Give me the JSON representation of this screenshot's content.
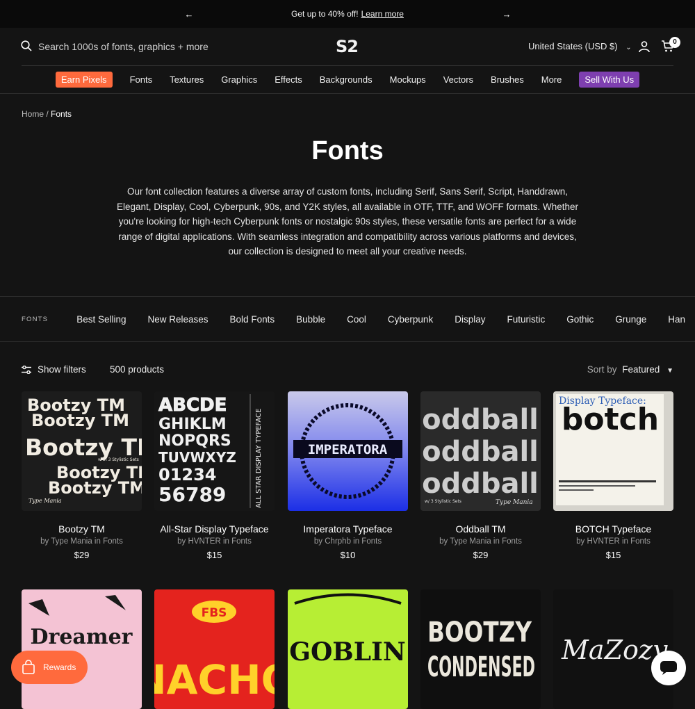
{
  "announcement": {
    "text": "Get up to 40% off!",
    "link": "Learn more"
  },
  "header": {
    "search_placeholder": "Search 1000s of fonts, graphics + more",
    "logo": "S2",
    "country": "United States (USD $)",
    "cart_count": "0"
  },
  "nav": {
    "promo_left": "Earn Pixels",
    "items": [
      "Fonts",
      "Textures",
      "Graphics",
      "Effects",
      "Backgrounds",
      "Mockups",
      "Vectors",
      "Brushes",
      "More"
    ],
    "promo_right": "Sell With Us"
  },
  "breadcrumb": {
    "home": "Home",
    "separator": "/",
    "current": "Fonts"
  },
  "page": {
    "title": "Fonts",
    "description": "Our font collection features a diverse array of custom fonts, including Serif, Sans Serif, Script, Handdrawn, Elegant, Display, Cool, Cyberpunk, 90s, and Y2K styles, all available in OTF, TTF, and WOFF formats. Whether you're looking for high-tech Cyberpunk fonts or nostalgic 90s styles, these versatile fonts are perfect for a wide range of digital applications. With seamless integration and compatibility across various platforms and devices, our collection is designed to meet all your creative needs."
  },
  "categories": {
    "label": "FONTS",
    "items": [
      "Best Selling",
      "New Releases",
      "Bold Fonts",
      "Bubble",
      "Cool",
      "Cyberpunk",
      "Display",
      "Futuristic",
      "Gothic",
      "Grunge",
      "Han"
    ]
  },
  "toolbar": {
    "filters": "Show filters",
    "count": "500 products",
    "sort_label": "Sort by",
    "sort_value": "Featured"
  },
  "products": [
    {
      "name": "Bootzy TM",
      "by": "by Type Mania in Fonts",
      "price": "$29"
    },
    {
      "name": "All-Star Display Typeface",
      "by": "by HVNTER in Fonts",
      "price": "$15"
    },
    {
      "name": "Imperatora Typeface",
      "by": "by Chrphb in Fonts",
      "price": "$10"
    },
    {
      "name": "Oddball TM",
      "by": "by Type Mania in Fonts",
      "price": "$29"
    },
    {
      "name": "BOTCH Typeface",
      "by": "by HVNTER in Fonts",
      "price": "$15"
    }
  ],
  "thumb_text": {
    "bootzy": [
      "Bootzy TM",
      "Bootzy TM",
      "Bootzy TM",
      "Bootzy TM",
      "Bootzy TM"
    ],
    "bootzy_sub": "with 3 Stylistic Sets",
    "type_mania": "Type Mania",
    "allstar_side": "ALL STAR DISPLAY TYPEFACE",
    "allstar_rows": [
      "ABCDE",
      "GHIKLM",
      "NOPQRS",
      "TUVWXYZ",
      "01234",
      "56789"
    ],
    "imperatora": "IMPERATORA",
    "oddball": "oddball",
    "oddball_sub": "w/ 3 Stylistic Sets",
    "botch_top": "Display Typeface:",
    "botch": "botch",
    "dreamer": "Dreamer",
    "fbs": "FBS",
    "nacho": "NACHO",
    "goblin": "GOBLIN",
    "bootzy_condensed": [
      "BOOTZY",
      "CONDENSED"
    ],
    "mazozy": "MaZozy"
  },
  "floating": {
    "rewards": "Rewards"
  },
  "colors": {
    "background": "#141414",
    "accent_orange": "#ff6a3d",
    "accent_purple": "#7e3fb0"
  }
}
